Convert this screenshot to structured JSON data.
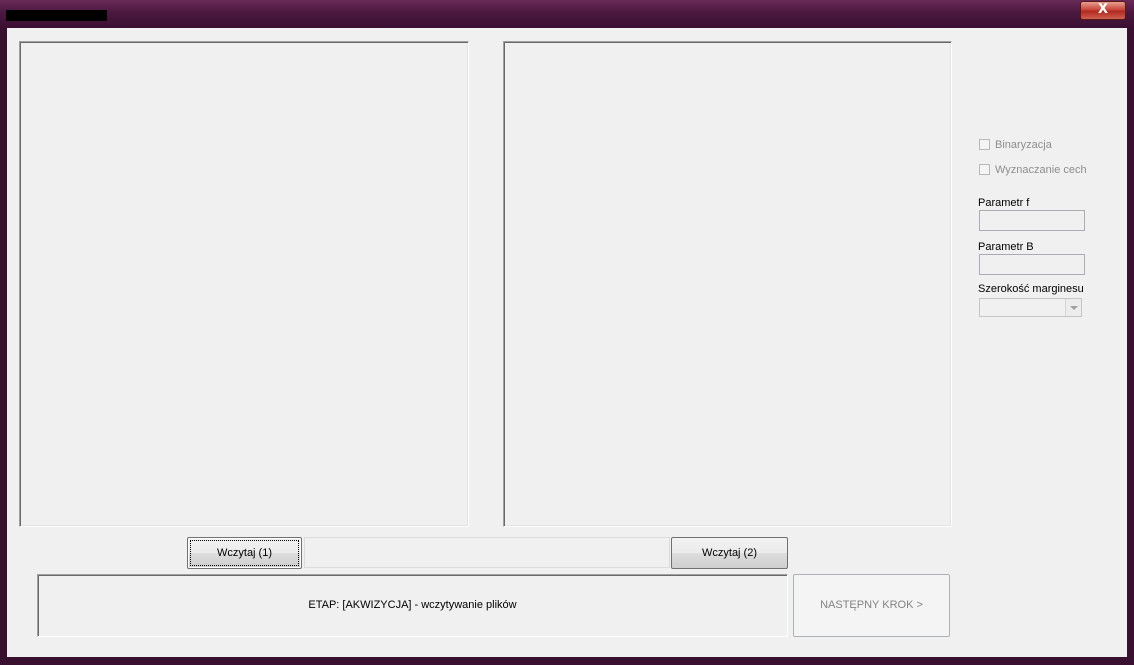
{
  "window": {
    "close_label": "X"
  },
  "buttons": {
    "load1": "Wczytaj (1)",
    "load2": "Wczytaj (2)",
    "next": "NASTĘPNY KROK >"
  },
  "status": {
    "text": "ETAP: [AKWIZYCJA] - wczytywanie plików"
  },
  "options": {
    "binarization": "Binaryzacja",
    "features": "Wyznaczanie cech"
  },
  "params": {
    "f_label": "Parametr f",
    "f_value": "",
    "b_label": "Parametr B",
    "b_value": "",
    "margin_label": "Szerokość marginesu",
    "margin_value": ""
  },
  "path_value": ""
}
